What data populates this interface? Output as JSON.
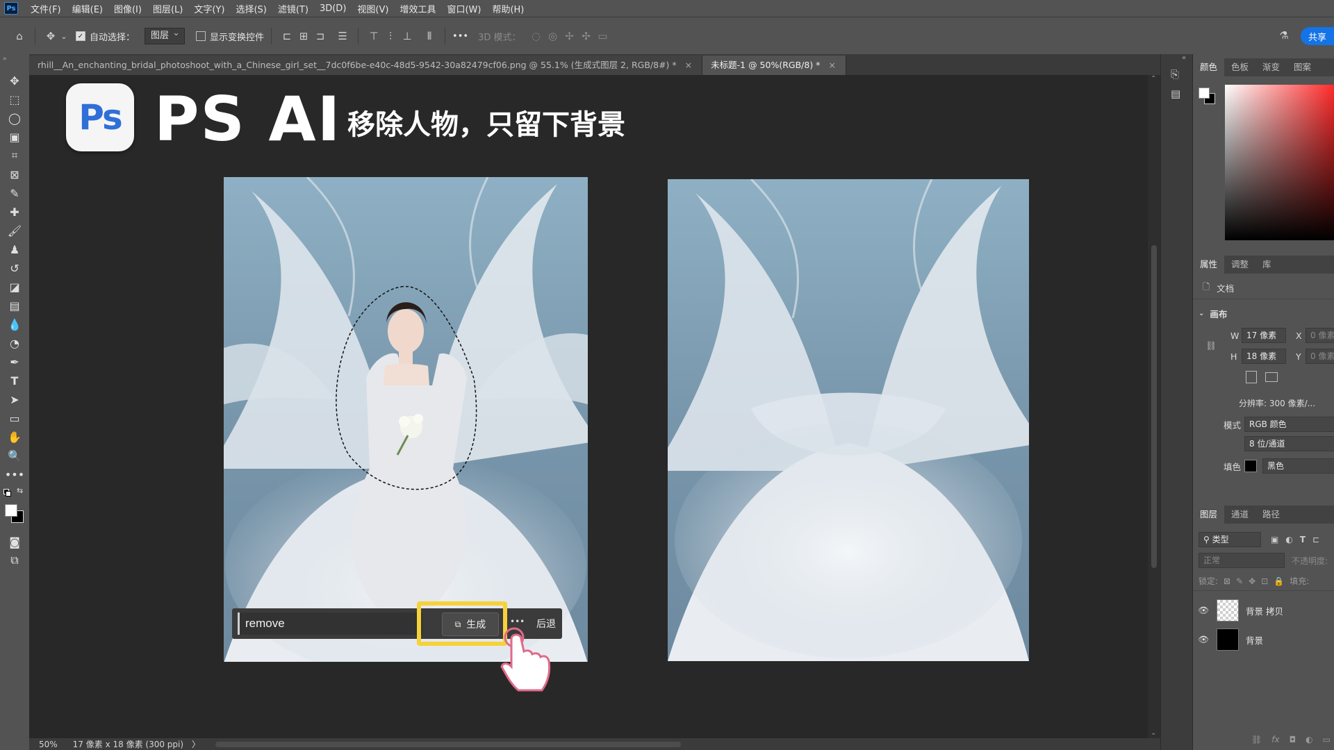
{
  "menubar": {
    "items": [
      "文件(F)",
      "编辑(E)",
      "图像(I)",
      "图层(L)",
      "文字(Y)",
      "选择(S)",
      "滤镜(T)",
      "3D(D)",
      "视图(V)",
      "增效工具",
      "窗口(W)",
      "帮助(H)"
    ],
    "app_icon": "Ps"
  },
  "options": {
    "auto_select_label": "自动选择：",
    "auto_select_target": "图层",
    "show_transform_label": "显示变换控件",
    "mode_3d_label": "3D 模式：",
    "more": "•••",
    "share_label": "共享"
  },
  "tabs": [
    {
      "label": "rhill__An_enchanting_bridal_photoshoot_with_a_Chinese_girl_set__7dc0f6be-e40c-48d5-9542-30a82479cf06.png @ 55.1% (生成式图层 2, RGB/8#) *",
      "close": "×"
    },
    {
      "label": "未标题-1 @ 50%(RGB/8) *",
      "close": "×"
    }
  ],
  "overlay": {
    "logo_text": "Ps",
    "title": "PS AI",
    "subtitle": "移除人物，只留下背景"
  },
  "generative_bar": {
    "prompt_value": "remove",
    "generate_label": "生成",
    "more": "•••",
    "back_label": "后退"
  },
  "status": {
    "zoom": "50%",
    "doc_info": "17 像素 x 18 像素 (300 ppi)",
    "arrow": "〉"
  },
  "color_panel": {
    "tabs": [
      "颜色",
      "色板",
      "渐变",
      "图案"
    ]
  },
  "properties_panel": {
    "tabs": [
      "属性",
      "调整",
      "库"
    ],
    "doc_label": "文档",
    "canvas_section": "画布",
    "w_label": "W",
    "w_value": "17 像素",
    "h_label": "H",
    "h_value": "18 像素",
    "x_label": "X",
    "x_value": "0 像素",
    "y_label": "Y",
    "y_value": "0 像素",
    "resolution": "分辨率: 300 像素/...",
    "mode_label": "模式",
    "mode_value": "RGB 颜色",
    "bit_value": "8 位/通道",
    "fill_label": "填色",
    "fill_value": "黑色"
  },
  "layers_panel": {
    "tabs": [
      "图层",
      "通道",
      "路径"
    ],
    "filter_label": "类型",
    "blend_mode": "正常",
    "opacity_label": "不透明度:",
    "lock_label": "锁定:",
    "fill_label": "填充:",
    "layers": [
      {
        "name": "背景 拷贝"
      },
      {
        "name": "背景"
      }
    ]
  },
  "colors": {
    "accent": "#1473e6",
    "highlight": "#f6d23a"
  }
}
